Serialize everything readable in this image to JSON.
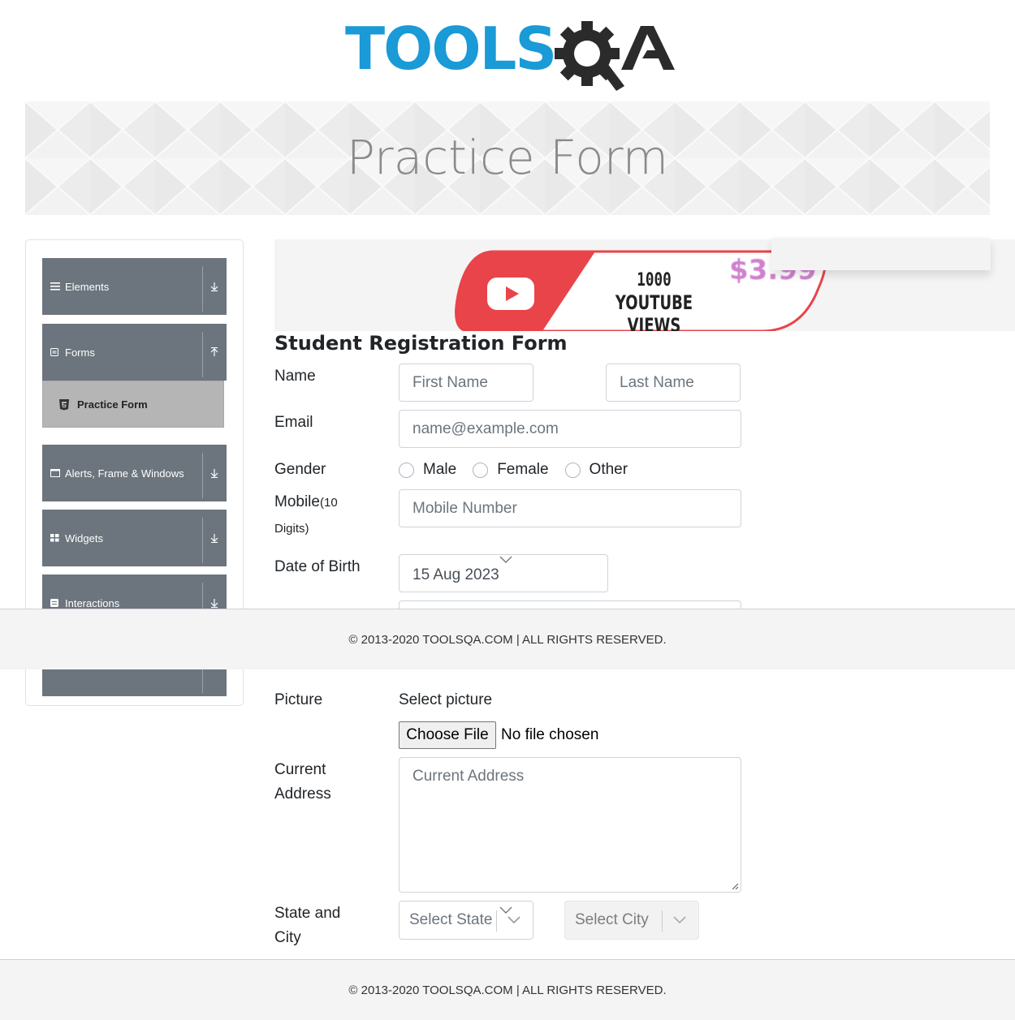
{
  "header": {
    "logo_text": "TOOLS",
    "logo_suffix": "QA",
    "page_title": "Practice Form"
  },
  "sidebar": {
    "groups": [
      {
        "label": "Elements",
        "icon": "hamburger-icon",
        "arrow": "⇊"
      },
      {
        "label": "Forms",
        "icon": "form-icon",
        "arrow": "⇈"
      },
      {
        "label": "Alerts, Frame & Windows",
        "icon": "window-icon",
        "arrow": "⇊"
      },
      {
        "label": "Widgets",
        "icon": "grid-icon",
        "arrow": "⇊"
      },
      {
        "label": "Interactions",
        "icon": "interaction-icon",
        "arrow": "⇊"
      }
    ],
    "active_item": {
      "label": "Practice Form",
      "icon": "html5-icon"
    }
  },
  "ad": {
    "line1": "1000",
    "line2": "YOUTUBE VIEWS",
    "price": "$3.99"
  },
  "form": {
    "title": "Student Registration Form",
    "name_label": "Name",
    "first_name_placeholder": "First Name",
    "last_name_placeholder": "Last Name",
    "email_label": "Email",
    "email_placeholder": "name@example.com",
    "gender_label": "Gender",
    "gender_options": [
      "Male",
      "Female",
      "Other"
    ],
    "mobile_label": "Mobile",
    "mobile_hint_a": "(10",
    "mobile_hint_b": "Digits)",
    "mobile_placeholder": "Mobile Number",
    "dob_label": "Date of Birth",
    "dob_value": "15 Aug 2023",
    "picture_label": "Picture",
    "picture_prompt": "Select picture",
    "choose_file_label": "Choose File",
    "no_file_text": "No file chosen",
    "address_label_a": "Current",
    "address_label_b": "Address",
    "address_placeholder": "Current Address",
    "state_city_label_a": "State and",
    "state_city_label_b": "City",
    "state_placeholder": "Select State",
    "city_placeholder": "Select City"
  },
  "footer": {
    "text": "© 2013-2020 TOOLSQA.COM | ALL RIGHTS RESERVED."
  }
}
